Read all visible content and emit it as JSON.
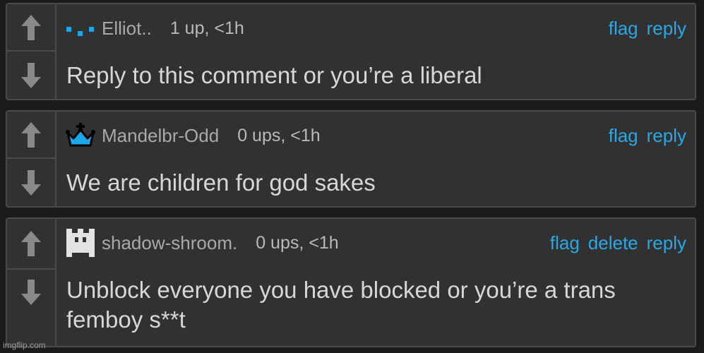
{
  "comments": [
    {
      "username": "Elliot..",
      "meta": "1 up, <1h",
      "actions": [
        "flag",
        "reply"
      ],
      "text": "Reply to this comment or you’re a liberal",
      "avatar_icon": "blue-dots-icon"
    },
    {
      "username": "Mandelbr-Odd",
      "meta": "0 ups, <1h",
      "actions": [
        "flag",
        "reply"
      ],
      "text": "We are children for god sakes",
      "avatar_icon": "crown-icon"
    },
    {
      "username": "shadow-shroom.",
      "meta": "0 ups, <1h",
      "actions": [
        "flag",
        "delete",
        "reply"
      ],
      "text": "Unblock everyone you have blocked or you’re a trans femboy s**t",
      "avatar_icon": "pixel-mask-icon"
    }
  ],
  "watermark": "imgflip.com",
  "colors": {
    "link": "#2aa7e4",
    "panel": "#313132",
    "border": "#4a4a4b",
    "arrow": "#8a8a8b"
  }
}
